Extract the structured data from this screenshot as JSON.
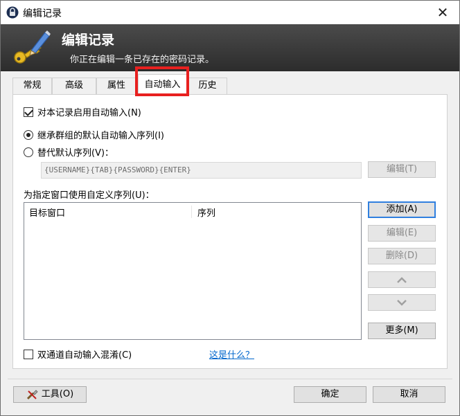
{
  "window": {
    "title": "编辑记录",
    "close_glyph": "✕"
  },
  "banner": {
    "heading": "编辑记录",
    "subheading": "你正在编辑一条已存在的密码记录。"
  },
  "tabs": [
    {
      "label": "常规"
    },
    {
      "label": "高级"
    },
    {
      "label": "属性"
    },
    {
      "label": "自动输入",
      "selected": true
    },
    {
      "label": "历史"
    }
  ],
  "autotype": {
    "enable_label": "对本记录启用自动输入(N)",
    "enable_checked": true,
    "inherit_label": "继承群组的默认自动输入序列(I)",
    "override_label": "替代默认序列(V)：",
    "selected_option": "inherit",
    "sequence_value": "{USERNAME}{TAB}{PASSWORD}{ENTER}",
    "edit_sequence_label": "编辑(T)",
    "custom_label": "为指定窗口使用自定义序列(U)：",
    "columns": [
      "目标窗口",
      "序列"
    ],
    "add_label": "添加(A)",
    "edit_label": "编辑(E)",
    "delete_label": "删除(D)",
    "more_label": "更多(M)",
    "obfuscation_label": "双通道自动输入混淆(C)",
    "obfuscation_checked": false,
    "whats_this_label": "这是什么？"
  },
  "footer": {
    "tools_label": "工具(O)",
    "ok_label": "确定",
    "cancel_label": "取消"
  },
  "colors": {
    "highlight": "#e8201f",
    "banner": "#2c2c2c",
    "link": "#0066cc"
  }
}
